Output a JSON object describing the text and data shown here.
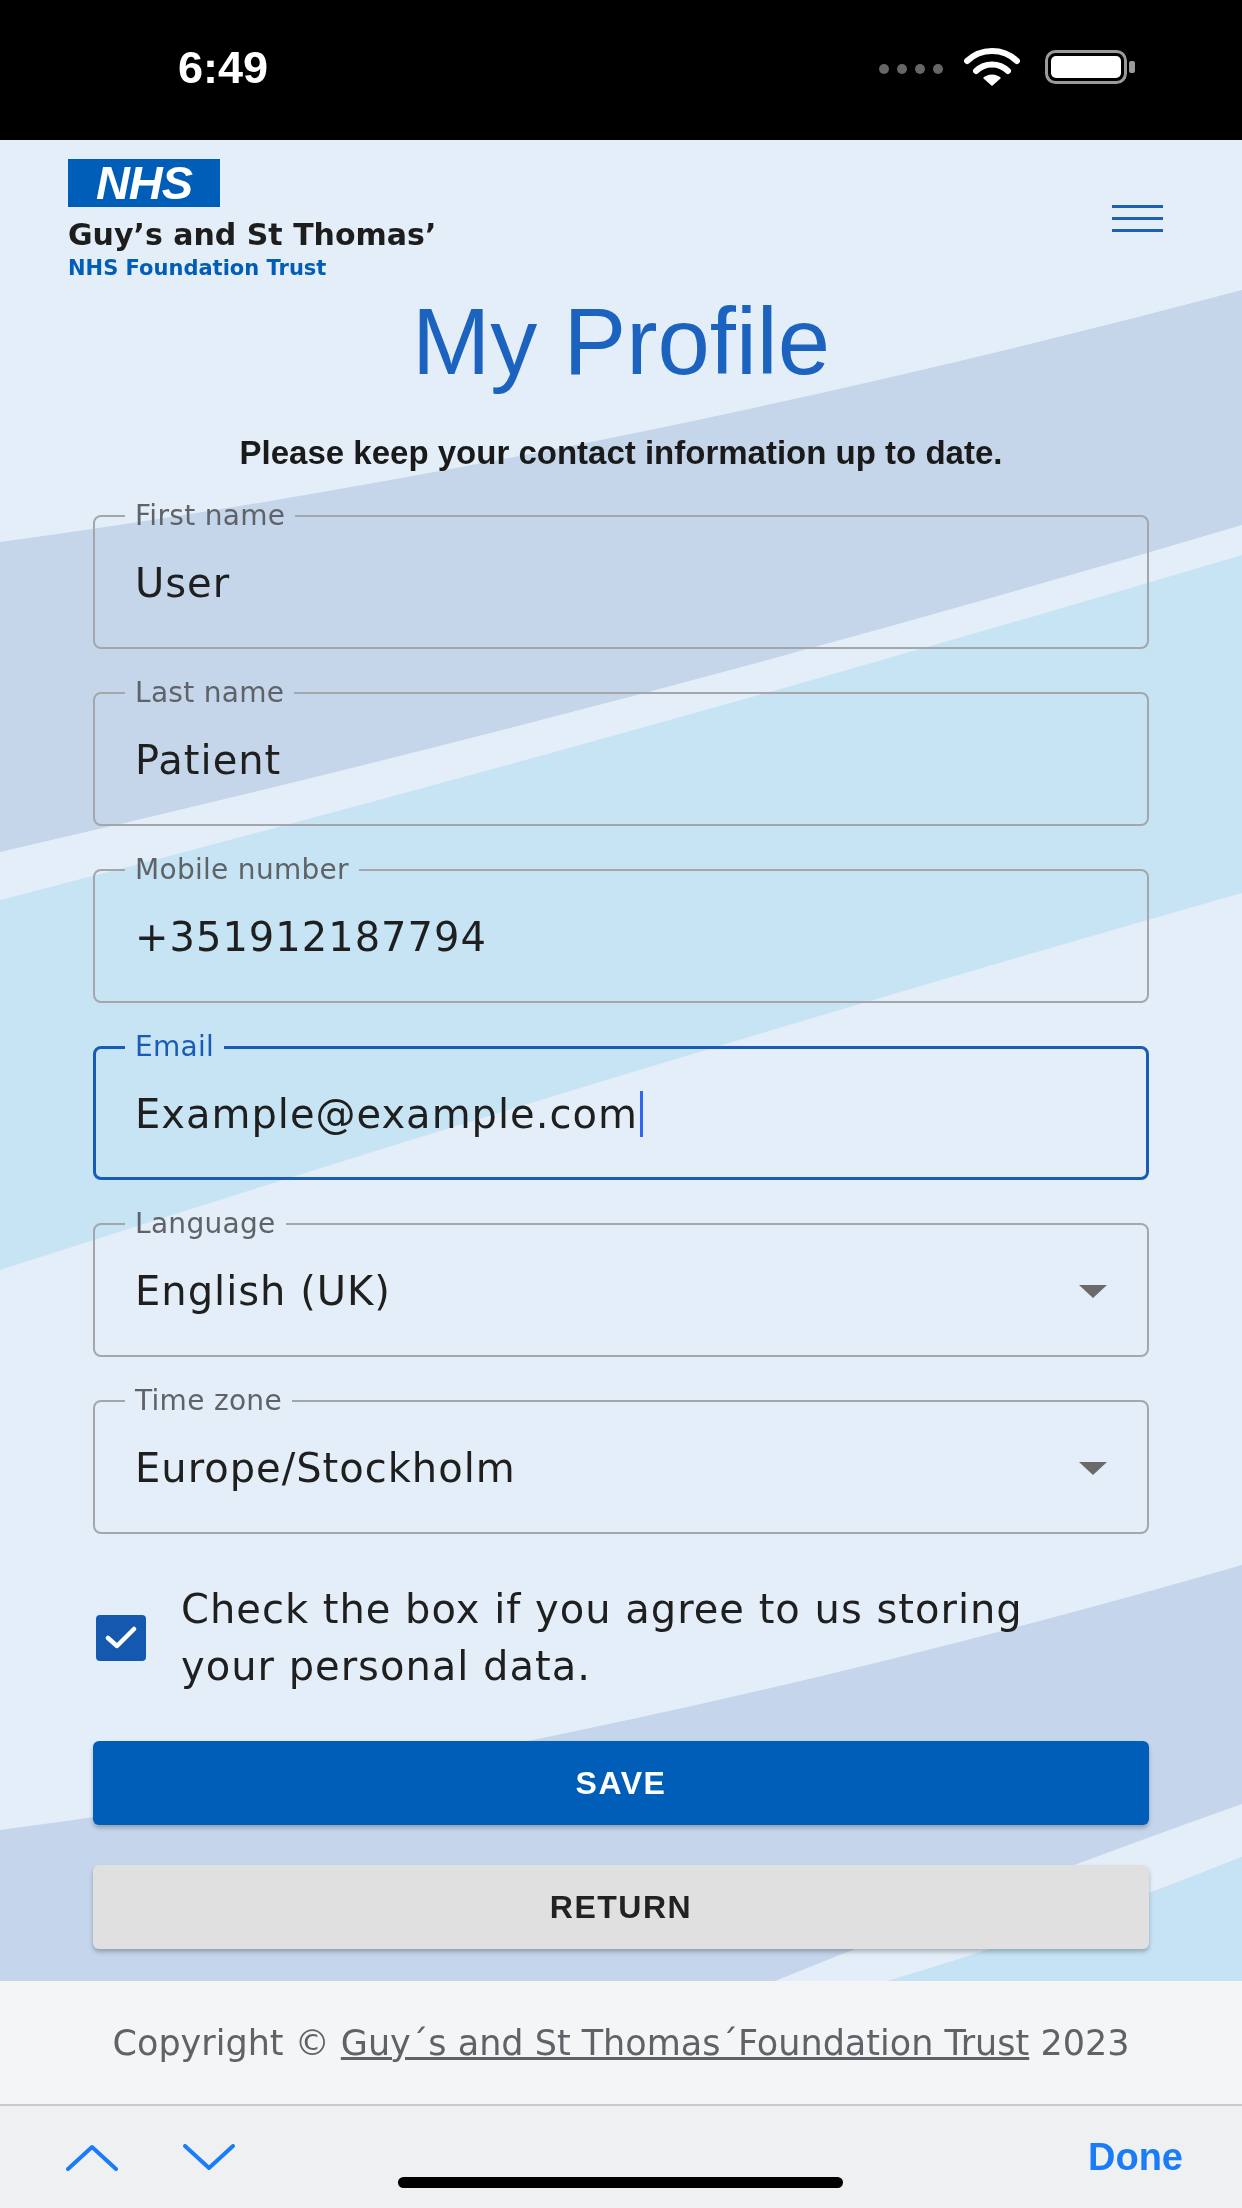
{
  "status_bar": {
    "time": "6:49"
  },
  "header": {
    "logo_text": "NHS",
    "organisation": "Guy’s and St Thomas’",
    "subtitle": "NHS Foundation Trust"
  },
  "title": "My Profile",
  "intro": "Please keep your contact information up to date.",
  "fields": [
    {
      "kind": "text",
      "label": "First name",
      "value": "User",
      "focused": false
    },
    {
      "kind": "text",
      "label": "Last name",
      "value": "Patient",
      "focused": false
    },
    {
      "kind": "text",
      "label": "Mobile number",
      "value": "+351912187794",
      "focused": false
    },
    {
      "kind": "text",
      "label": "Email",
      "value": "Example@example.com",
      "focused": true
    },
    {
      "kind": "select",
      "label": "Language",
      "value": "English (UK)",
      "focused": false
    },
    {
      "kind": "select",
      "label": "Time zone",
      "value": "Europe/Stockholm",
      "focused": false
    }
  ],
  "consent": {
    "label": "Check the box if you agree to us storing your personal data.",
    "checked": true
  },
  "buttons": [
    {
      "kind": "primary",
      "label": "SAVE"
    },
    {
      "kind": "secondary",
      "label": "RETURN"
    }
  ],
  "footer": {
    "prefix": "Copyright ©",
    "link": "Guy´s and St Thomas´Foundation Trust",
    "suffix": "2023"
  },
  "keyboard_toolbar": {
    "done": "Done"
  }
}
